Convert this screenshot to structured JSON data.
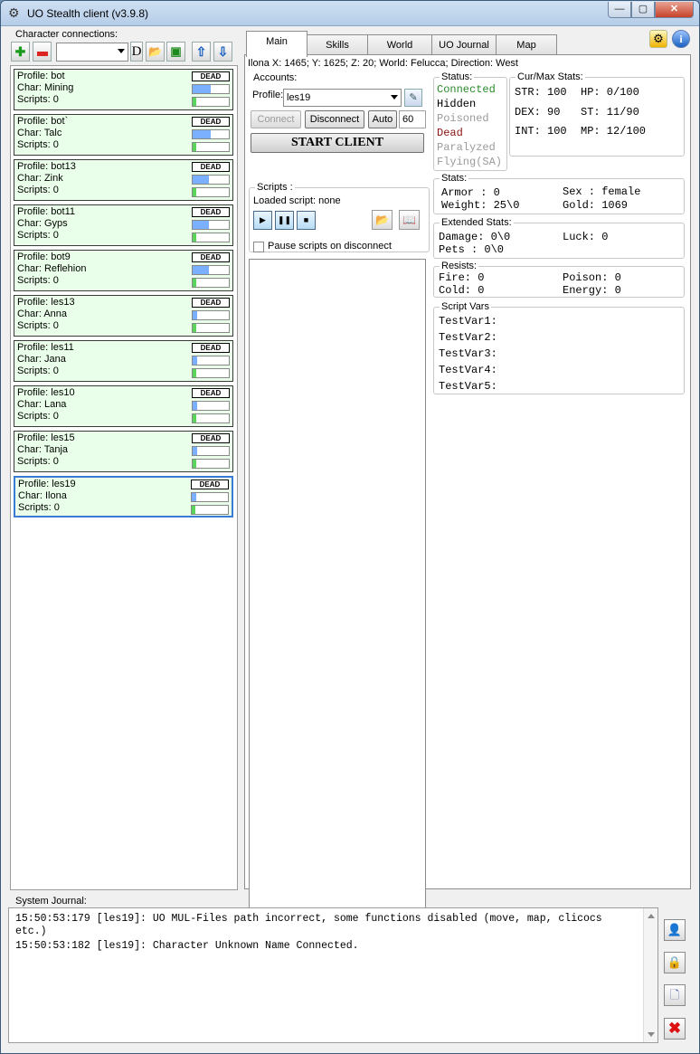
{
  "window": {
    "title": "UO Stealth client (v3.9.8)",
    "buttons": {
      "minimize": "—",
      "maximize": "▢",
      "close": "✕"
    }
  },
  "left": {
    "caption": "Character connections:",
    "toolbar": {
      "d_label": "D"
    },
    "connections": [
      {
        "profile": "Profile: bot",
        "char": "Char: Mining",
        "scripts": "Scripts: 0",
        "status": "DEAD",
        "hp": 0.5,
        "st": 0.1
      },
      {
        "profile": "Profile: bot`",
        "char": "Char: Talc",
        "scripts": "Scripts: 0",
        "status": "DEAD",
        "hp": 0.5,
        "st": 0.1
      },
      {
        "profile": "Profile: bot13",
        "char": "Char: Zink",
        "scripts": "Scripts: 0",
        "status": "DEAD",
        "hp": 0.45,
        "st": 0.1
      },
      {
        "profile": "Profile: bot11",
        "char": "Char: Gyps",
        "scripts": "Scripts: 0",
        "status": "DEAD",
        "hp": 0.45,
        "st": 0.1
      },
      {
        "profile": "Profile: bot9",
        "char": "Char: Reflehion",
        "scripts": "Scripts: 0",
        "status": "DEAD",
        "hp": 0.45,
        "st": 0.1
      },
      {
        "profile": "Profile: les13",
        "char": "Char: Anna",
        "scripts": "Scripts: 0",
        "status": "DEAD",
        "hp": 0.12,
        "st": 0.1
      },
      {
        "profile": "Profile: les11",
        "char": "Char: Jana",
        "scripts": "Scripts: 0",
        "status": "DEAD",
        "hp": 0.12,
        "st": 0.1
      },
      {
        "profile": "Profile: les10",
        "char": "Char: Lana",
        "scripts": "Scripts: 0",
        "status": "DEAD",
        "hp": 0.12,
        "st": 0.1
      },
      {
        "profile": "Profile: les15",
        "char": "Char: Tanja",
        "scripts": "Scripts: 0",
        "status": "DEAD",
        "hp": 0.12,
        "st": 0.1
      },
      {
        "profile": "Profile: les19",
        "char": "Char: Ilona",
        "scripts": "Scripts: 0",
        "status": "DEAD",
        "hp": 0.12,
        "st": 0.1
      }
    ]
  },
  "tabs": [
    "Main",
    "Skills",
    "World",
    "UO Journal",
    "Map"
  ],
  "info_line": "Ilona X: 1465; Y: 1625; Z: 20; World: Felucca; Direction: West",
  "accounts": {
    "legend": "Accounts:",
    "profile_label": "Profile:",
    "profile_value": "les19",
    "connect": "Connect",
    "disconnect": "Disconnect",
    "auto": "Auto",
    "auto_value": "60",
    "start": "START  CLIENT"
  },
  "scripts": {
    "legend": "Scripts :",
    "loaded": "Loaded script:  none",
    "pause_label": "Pause scripts on disconnect"
  },
  "status": {
    "legend": "Status:",
    "items": [
      {
        "label": "Connected",
        "color": "#2a8a2a"
      },
      {
        "label": "Hidden",
        "color": "#000000"
      },
      {
        "label": "Poisoned",
        "color": "#9a9a9a"
      },
      {
        "label": "Dead",
        "color": "#8b1010"
      },
      {
        "label": "Paralyzed",
        "color": "#9a9a9a"
      },
      {
        "label": "Flying(SA)",
        "color": "#9a9a9a"
      }
    ]
  },
  "curmax": {
    "legend": "Cur/Max Stats:",
    "str": "STR: 100",
    "hp": "HP:  0/100",
    "dex": "DEX: 90",
    "st": "ST:  11/90",
    "int": "INT: 100",
    "mp": "MP:  12/100"
  },
  "stats": {
    "legend": "Stats:",
    "armor": "Armor : 0",
    "sex": "Sex : female",
    "weight": "Weight: 25\\0",
    "gold": "Gold:   1069"
  },
  "extended": {
    "legend": "Extended Stats:",
    "damage": "Damage: 0\\0",
    "luck": "Luck:  0",
    "pets": "Pets  : 0\\0"
  },
  "resists": {
    "legend": "Resists:",
    "fire": "Fire: 0",
    "poison": "Poison: 0",
    "cold": "Cold: 0",
    "energy": "Energy: 0"
  },
  "script_vars": {
    "legend": "Script Vars",
    "vars": [
      "TestVar1:",
      "TestVar2:",
      "TestVar3:",
      "TestVar4:",
      "TestVar5:"
    ]
  },
  "journal": {
    "caption": "System Journal:",
    "entries": [
      "15:50:53:179 [les19]: UO MUL-Files path incorrect, some functions disabled (move, map, clicocs etc.)",
      "15:50:53:182 [les19]: Character Unknown Name Connected."
    ]
  },
  "colors": {
    "accent": "#3a7bd5",
    "conn_bg": "#eaffea",
    "hp_fill": "#7ab0ff",
    "st_fill": "#5ad45a"
  }
}
